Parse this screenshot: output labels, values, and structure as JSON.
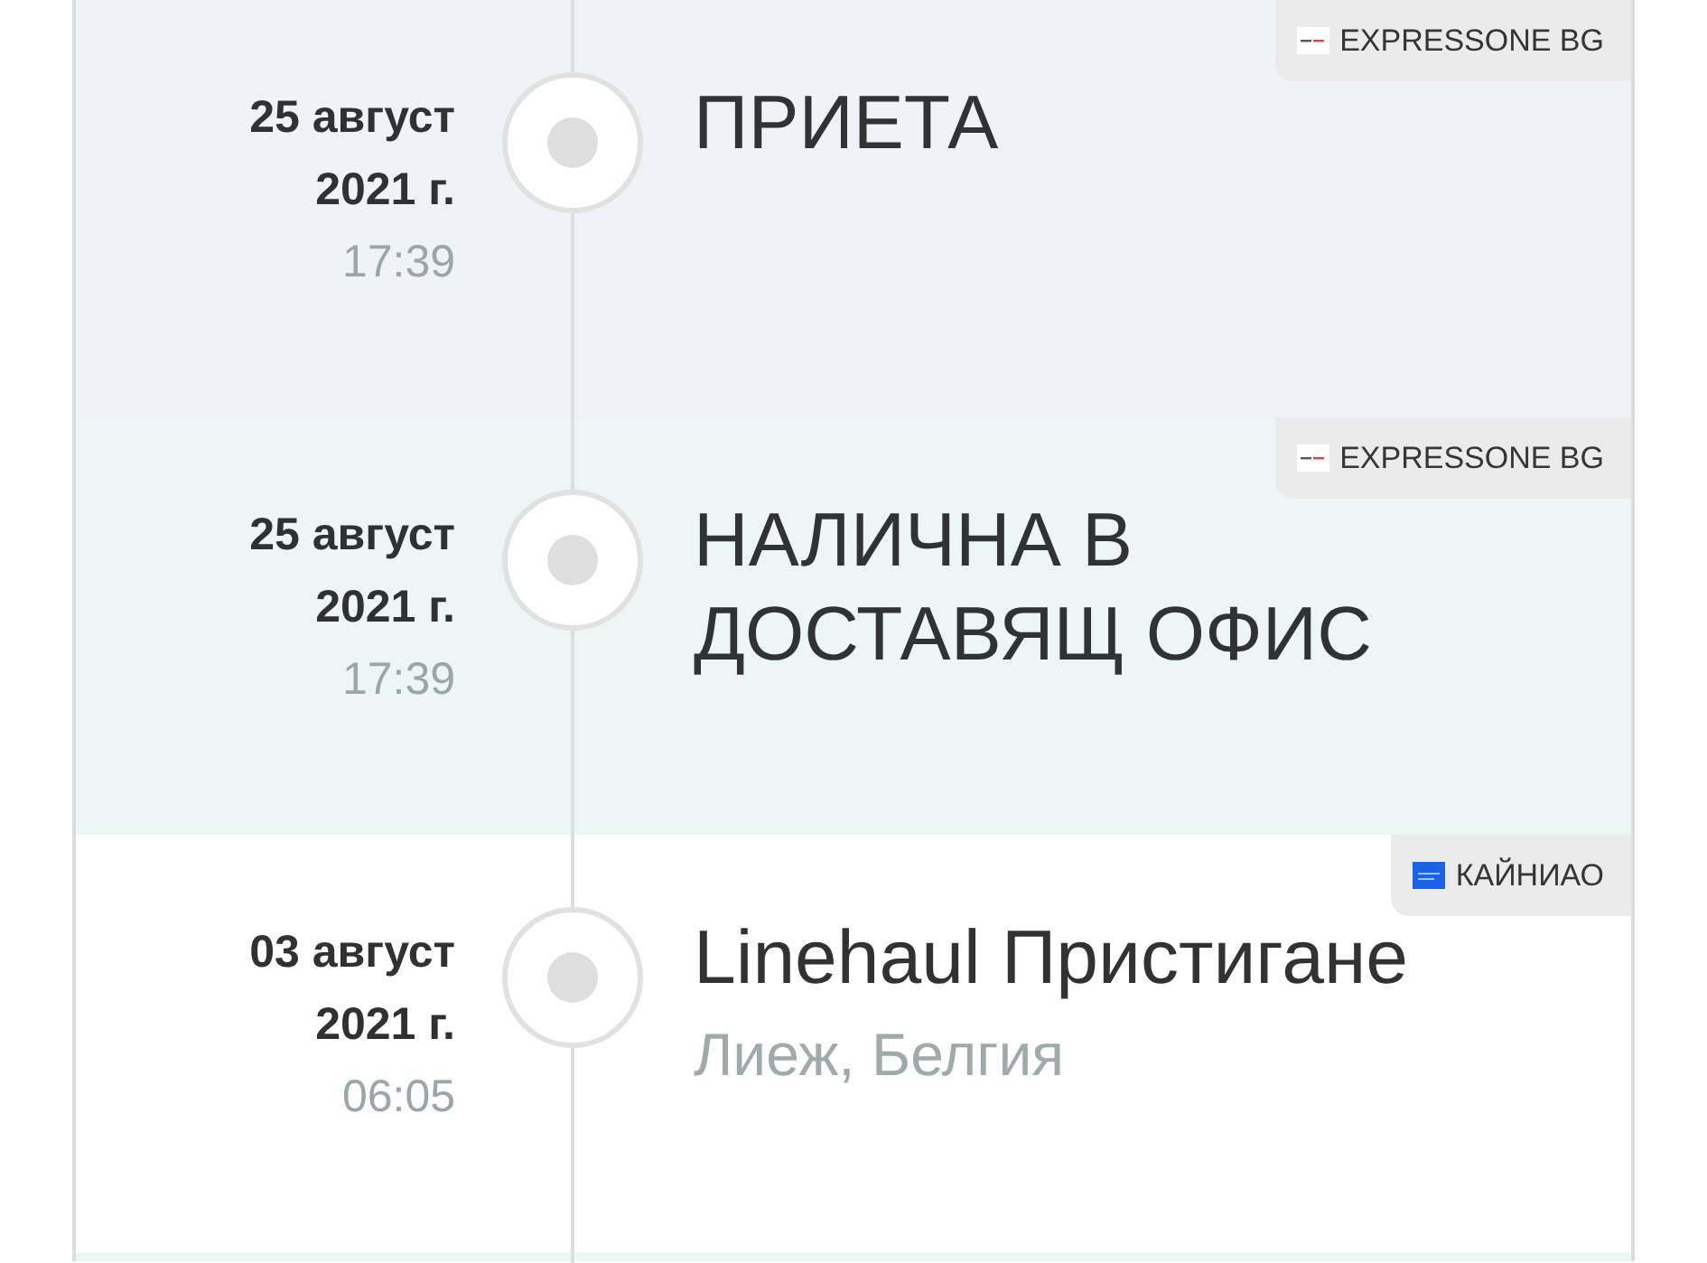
{
  "events": [
    {
      "date": "25 август 2021 г.",
      "time": "17:39",
      "status": "ПРИЕТА",
      "carrier": {
        "kind": "expressone",
        "name": "EXPRESSONE BG"
      },
      "color": "#eff3f8"
    },
    {
      "date": "25 август 2021 г.",
      "time": "17:39",
      "status": "НАЛИЧНА В ДОСТАВЯЩ ОФИС",
      "carrier": {
        "kind": "expressone",
        "name": "EXPRESSONE BG"
      },
      "color": "#eef5f5"
    },
    {
      "date": "03 август 2021 г.",
      "time": "06:05",
      "status": "Linehaul Пристигане",
      "location": "Лиеж, Белгия",
      "carrier": {
        "kind": "cainiao",
        "name": "КАЙНИАО"
      },
      "color": "#ffffff"
    },
    {
      "color": "#eef5f5"
    }
  ]
}
